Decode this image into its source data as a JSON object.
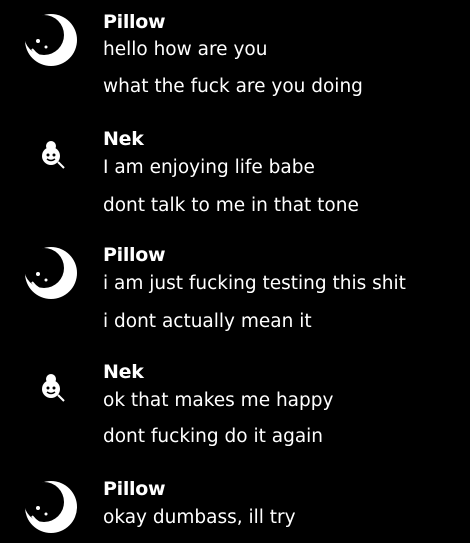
{
  "messages": [
    {
      "author": "Pillow",
      "timestamp": "",
      "avatar_icon": "moon-avatar-icon",
      "lines": [
        "hello how are you",
        "what the fuck are you doing"
      ]
    },
    {
      "author": "Nek",
      "timestamp": "",
      "avatar_icon": "character-avatar-icon",
      "lines": [
        "I am enjoying life babe",
        "dont talk to me in that tone"
      ]
    },
    {
      "author": "Pillow",
      "timestamp": "",
      "avatar_icon": "moon-avatar-icon",
      "lines": [
        "i am just fucking testing this shit",
        "i dont actually mean it"
      ]
    },
    {
      "author": "Nek",
      "timestamp": "",
      "avatar_icon": "character-avatar-icon",
      "lines": [
        "ok that makes me happy",
        "dont fucking do it again"
      ]
    },
    {
      "author": "Pillow",
      "timestamp": "",
      "avatar_icon": "moon-avatar-icon",
      "lines": [
        "okay dumbass, ill try"
      ]
    }
  ],
  "colors": {
    "background": "#000000",
    "text": "#ffffff",
    "timestamp": "#2a2a2a"
  }
}
